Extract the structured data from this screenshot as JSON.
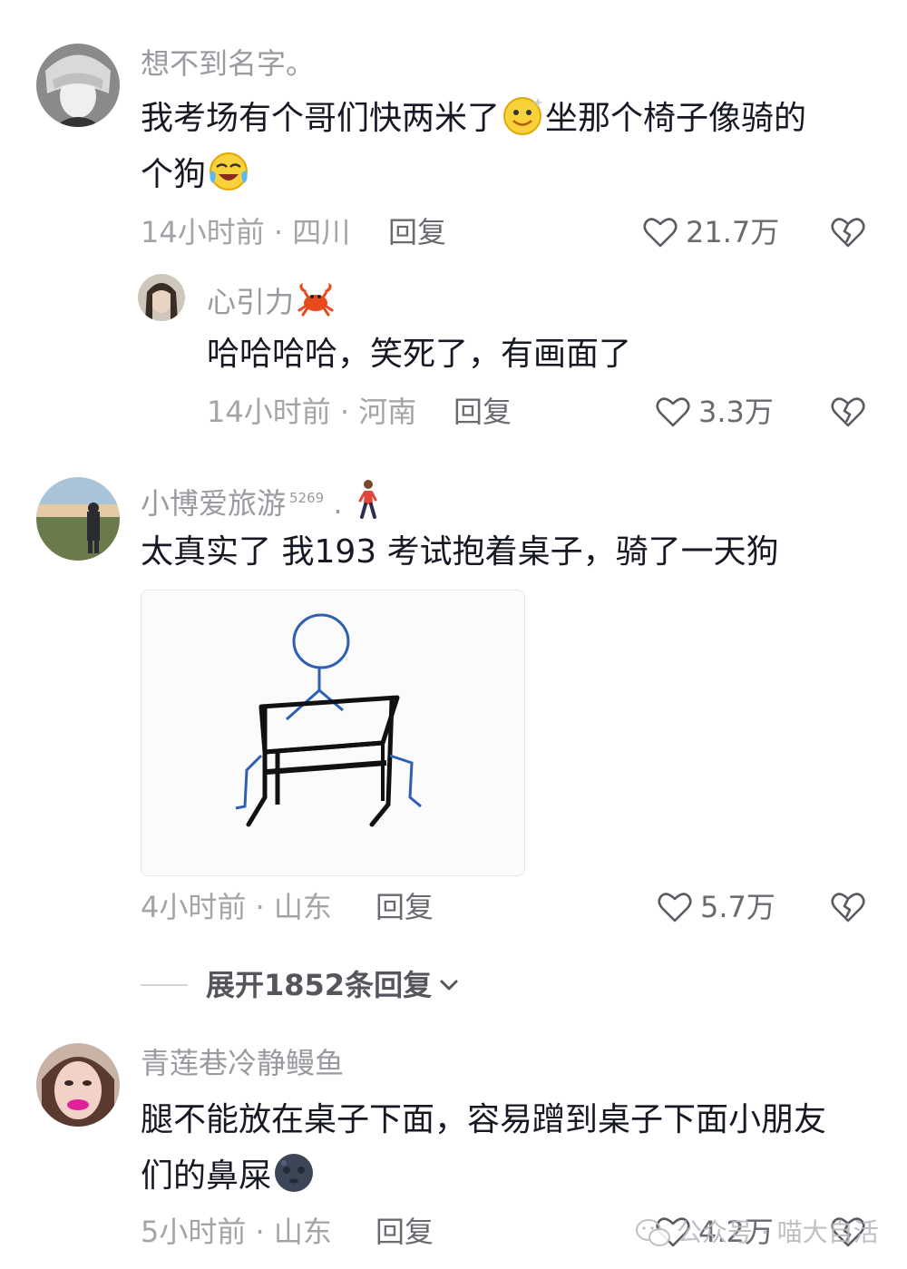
{
  "comments": [
    {
      "username": "想不到名字。",
      "text_a": "我考场有个哥们快两米了",
      "emoji_a": "smiling-face-icon",
      "text_b": "坐那个椅子像骑的",
      "text_c": "个狗",
      "emoji_b": "crying-laughing-icon",
      "time_location": "14小时前 · 四川",
      "reply_label": "回复",
      "likes": "21.7万"
    },
    {
      "username": "心引力",
      "emoji_name": "crab-icon",
      "text": "哈哈哈哈，笑死了，有画面了",
      "time_location": "14小时前 · 河南",
      "reply_label": "回复",
      "likes": "3.3万"
    },
    {
      "username": "小博爱旅游",
      "badge": "5269",
      "suffix": ".",
      "emoji_name": "person-walking-icon",
      "text": "太真实了 我193 考试抱着桌子，骑了一天狗",
      "image_name": "stick-figure-riding-desk-drawing",
      "time_location": "4小时前 · 山东",
      "reply_label": "回复",
      "likes": "5.7万"
    },
    {
      "username": "青莲巷冷静鳗鱼",
      "text_a": "腿不能放在桌子下面，容易蹭到桌子下面小朋友",
      "text_b": "们的鼻屎",
      "emoji_name": "new-moon-face-icon",
      "time_location": "5小时前 · 山东",
      "reply_label": "回复",
      "likes": "4.2万"
    }
  ],
  "expand_replies": "展开1852条回复",
  "watermark": "公众号 · 喵大自活",
  "colors": {
    "primary_text": "#161823",
    "secondary_text": "#9a9aa0",
    "drawing_blue": "#2f5fb3",
    "drawing_black": "#111111"
  }
}
